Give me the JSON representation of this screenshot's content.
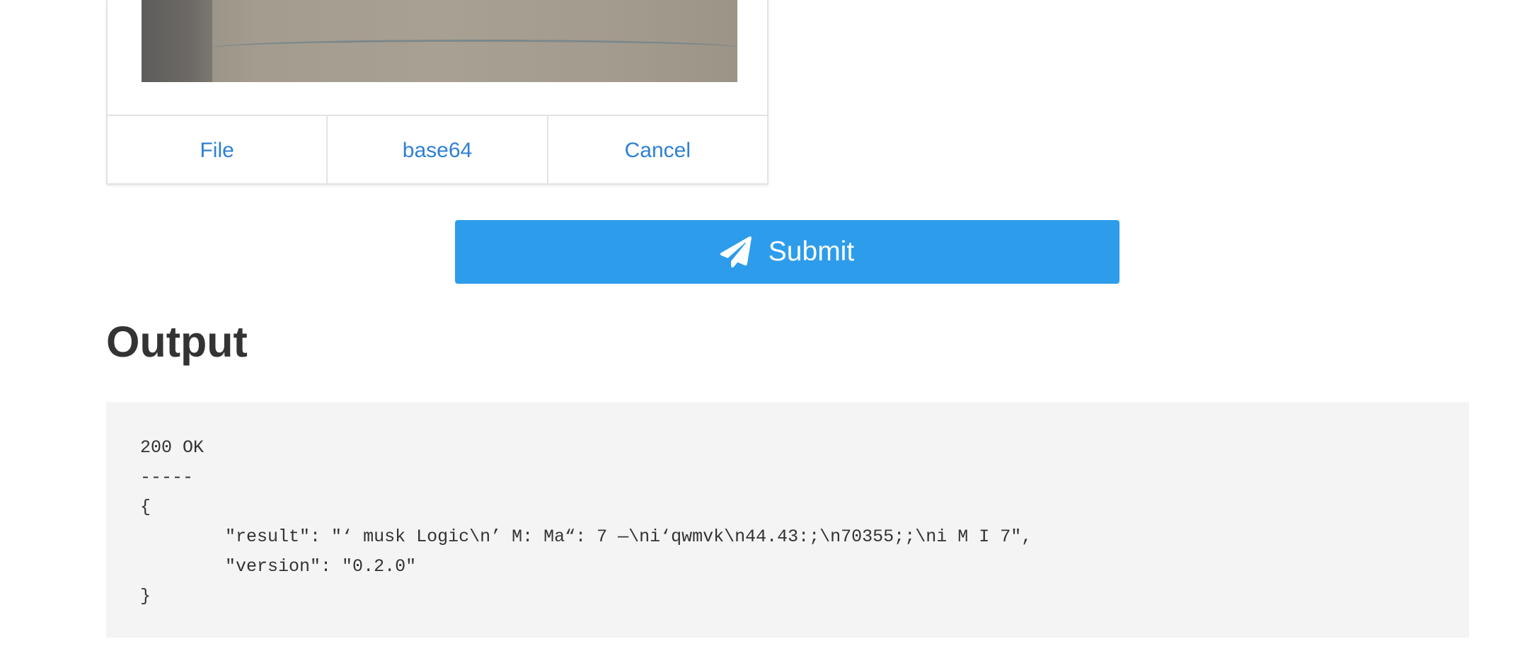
{
  "upload_card": {
    "image_alt": "uploaded photo preview",
    "actions": [
      {
        "label": "File"
      },
      {
        "label": "base64"
      },
      {
        "label": "Cancel"
      }
    ]
  },
  "submit": {
    "icon": "paper-plane-icon",
    "label": "Submit"
  },
  "output": {
    "title": "Output",
    "response_text": "200 OK\n-----\n{\n\t\"result\": \"‘ musk Logic\\n’ M: Ma“: 7 —\\ni‘qwmvk\\n44.43:;\\n70355;;\\ni M I 7\",\n\t\"version\": \"0.2.0\"\n}"
  },
  "colors": {
    "accent": "#2d9ceb",
    "link": "#2f80d3",
    "panel_bg": "#f4f4f4",
    "text": "#333333"
  }
}
